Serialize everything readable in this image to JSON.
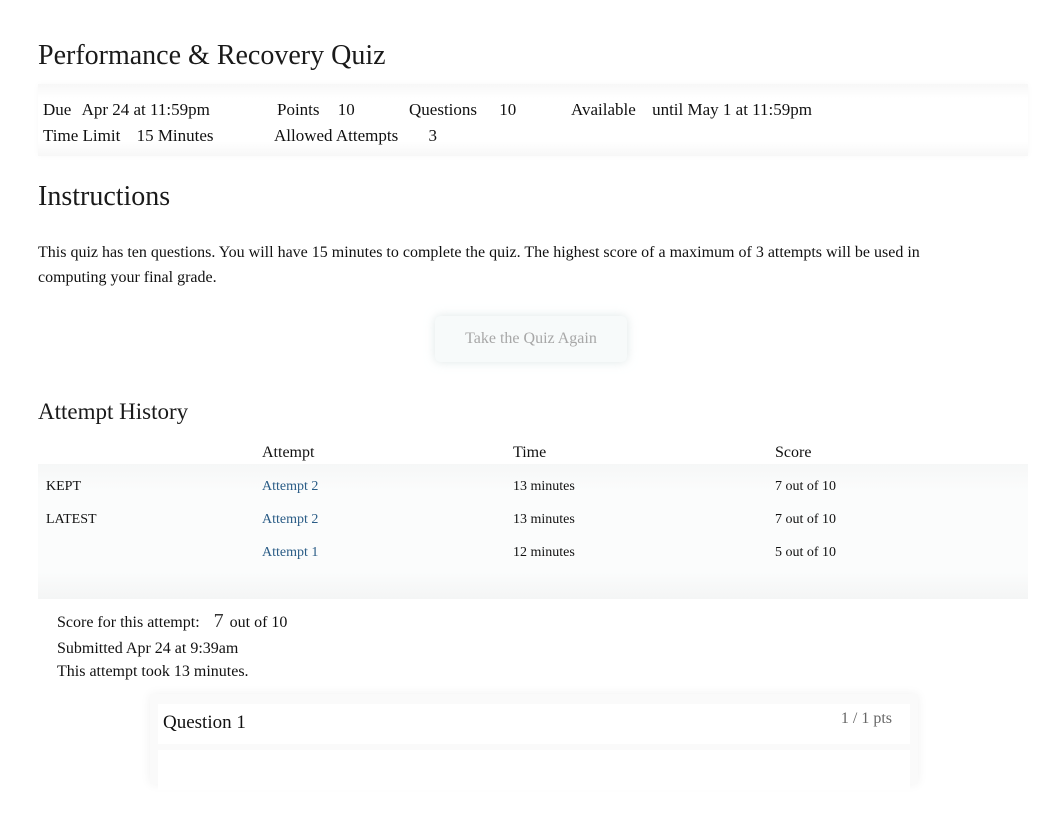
{
  "quiz": {
    "title": "Performance & Recovery Quiz",
    "details": {
      "due_label": "Due",
      "due_value": "Apr 24 at 11:59pm",
      "points_label": "Points",
      "points_value": "10",
      "questions_label": "Questions",
      "questions_value": "10",
      "available_label": "Available",
      "available_value": "until May 1 at 11:59pm",
      "time_limit_label": "Time Limit",
      "time_limit_value": "15 Minutes",
      "allowed_attempts_label": "Allowed Attempts",
      "allowed_attempts_value": "3"
    }
  },
  "instructions": {
    "heading": "Instructions",
    "text": "This quiz has ten questions. You will have 15 minutes to complete the quiz. The highest score of a maximum of 3 attempts will be used in computing your final grade."
  },
  "actions": {
    "take_again_label": "Take the Quiz Again"
  },
  "attempt_history": {
    "heading": "Attempt History",
    "columns": [
      "",
      "Attempt",
      "Time",
      "Score"
    ],
    "rows": [
      {
        "status": "KEPT",
        "attempt": "Attempt 2",
        "time": "13 minutes",
        "score": "7 out of 10"
      },
      {
        "status": "LATEST",
        "attempt": "Attempt 2",
        "time": "13 minutes",
        "score": "7 out of 10"
      },
      {
        "status": "",
        "attempt": "Attempt 1",
        "time": "12 minutes",
        "score": "5 out of 10"
      }
    ]
  },
  "attempt_summary": {
    "score_label": "Score for this attempt:",
    "score_value": "7",
    "score_suffix": "out of 10",
    "submitted": "Submitted Apr 24 at 9:39am",
    "duration": "This attempt took 13 minutes."
  },
  "questions": [
    {
      "name": "Question 1",
      "points": "1 / 1 pts"
    }
  ]
}
